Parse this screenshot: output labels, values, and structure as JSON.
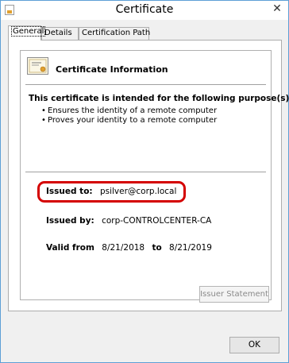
{
  "window": {
    "title": "Certificate"
  },
  "tabs": [
    {
      "label": "General",
      "active": true
    },
    {
      "label": "Details",
      "active": false
    },
    {
      "label": "Certification Path",
      "active": false
    }
  ],
  "info": {
    "title": "Certificate Information",
    "icon": "certificate-icon",
    "purpose_heading": "This certificate is intended for the following purpose(s):",
    "purposes": [
      "Ensures the identity of a remote computer",
      "Proves your identity to a remote computer"
    ],
    "issued_to_label": "Issued to:",
    "issued_to_value": "psilver@corp.local",
    "issued_by_label": "Issued by:",
    "issued_by_value": "corp-CONTROLCENTER-CA",
    "valid_from_label": "Valid from",
    "valid_from_value": "8/21/2018",
    "valid_to_label": "to",
    "valid_to_value": "8/21/2019",
    "highlight_color": "#d40000"
  },
  "buttons": {
    "issuer_statement": "Issuer Statement",
    "ok": "OK"
  }
}
